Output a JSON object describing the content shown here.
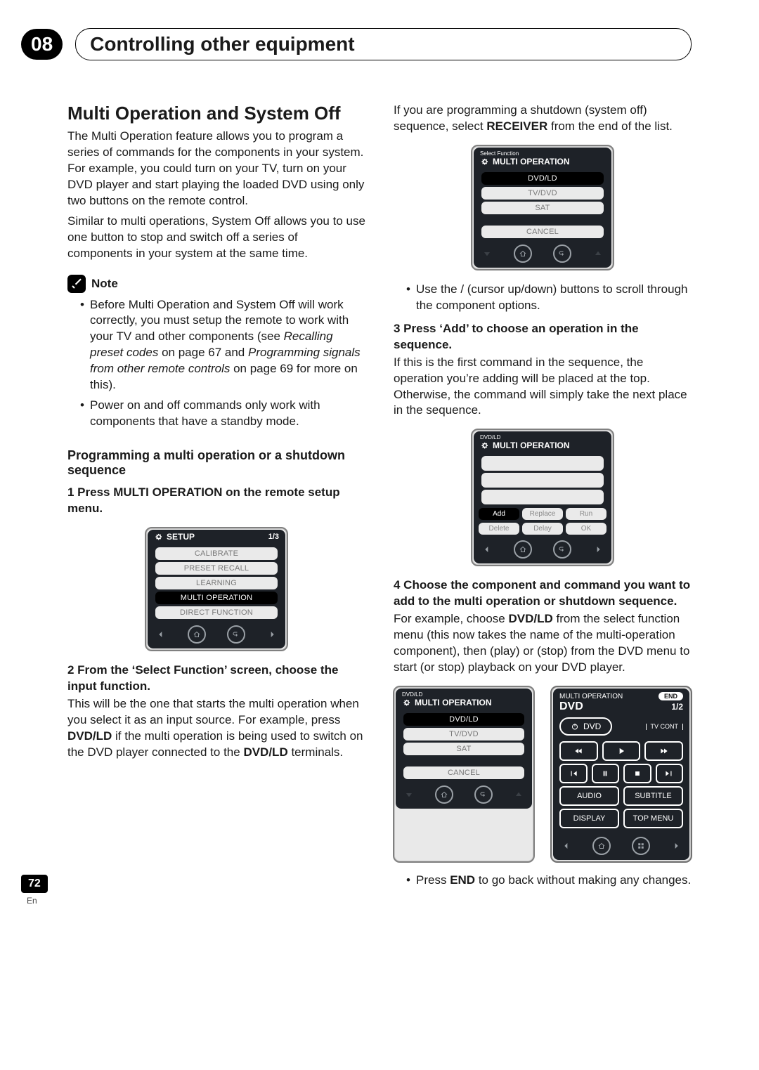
{
  "chapter": {
    "number": "08",
    "title": "Controlling other equipment"
  },
  "section_title": "Multi Operation and System Off",
  "intro_p1": "The Multi Operation feature allows you to program a series of commands for the components in your system. For example, you could turn on your TV, turn on your DVD player and start playing the loaded DVD using only two buttons on the remote control.",
  "intro_p2": "Similar to multi operations, System Off allows you to use one button to stop and switch off a series of components in your system at the same time.",
  "note_label": "Note",
  "note_b1_a": "Before Multi Operation and System Off will work correctly, you must setup the remote to work with your TV and other components (see ",
  "note_b1_i1": "Recalling preset codes",
  "note_b1_b": " on page 67 and ",
  "note_b1_i2": "Programming signals from other remote controls",
  "note_b1_c": " on page 69 for more on this).",
  "note_b2": "Power on and off commands only work with components that have a standby mode.",
  "subheading": "Programming a multi operation or a shutdown sequence",
  "step1": "1   Press MULTI OPERATION on the remote setup menu.",
  "lcd_setup": {
    "title": "SETUP",
    "page": "1/3",
    "items": [
      "CALIBRATE",
      "PRESET RECALL",
      "LEARNING",
      "MULTI OPERATION",
      "DIRECT FUNCTION"
    ],
    "selected": 3
  },
  "step2_t": "2   From the ‘Select Function’ screen, choose the input function.",
  "step2_p_a": "This will be the one that starts the multi operation when you select it as an input source. For example, press ",
  "step2_p_b": "DVD/LD",
  "step2_p_c": " if the multi operation is being used to switch on the DVD player connected to the ",
  "step2_p_d": "DVD/LD",
  "step2_p_e": " terminals.",
  "right_intro_a": "If you are programming a shutdown (system off) sequence, select ",
  "right_intro_b": "RECEIVER",
  "right_intro_c": " from the end of the list.",
  "lcd_selfn": {
    "crumb": "Select Function",
    "title": "MULTI OPERATION",
    "items": [
      "DVD/LD",
      "TV/DVD",
      "SAT"
    ],
    "cancel": "CANCEL",
    "selected": 0
  },
  "tip1_a": "Use the ",
  "tip1_arrows": " / ",
  "tip1_b": " (cursor up/down) buttons to scroll through the component options.",
  "step3_t": "3   Press ‘Add’ to choose an operation in the sequence.",
  "step3_p": "If this is the first command in the sequence, the operation you’re adding will be placed at the top. Otherwise, the command will simply take the next place in the sequence.",
  "lcd_add": {
    "crumb": "DVD/LD",
    "title": "MULTI OPERATION",
    "buttons_row1": [
      "Add",
      "Replace",
      "Run"
    ],
    "buttons_row2": [
      "Delete",
      "Delay",
      "OK"
    ],
    "selected": 0
  },
  "step4_t": "4   Choose the component and command you want to add to the multi operation or shutdown sequence.",
  "step4_p_a": "For example, choose ",
  "step4_p_b": "DVD/LD",
  "step4_p_c": " from the select function menu (this now takes the name of the multi-operation component), then      (play) or      (stop) from the DVD menu to start (or stop) playback on your DVD player.",
  "lcd_selfn2": {
    "crumb": "DVD/LD",
    "title": "MULTI OPERATION",
    "items": [
      "DVD/LD",
      "TV/DVD",
      "SAT"
    ],
    "cancel": "CANCEL",
    "selected": 0
  },
  "lcd_dvd": {
    "pre": "MULTI OPERATION",
    "end": "END",
    "title": "DVD",
    "page": "1/2",
    "power_label": "DVD",
    "tv_cont": "TV\nCONT",
    "labels": {
      "audio": "AUDIO",
      "subtitle": "SUBTITLE",
      "display": "DISPLAY",
      "topmenu": "TOP MENU"
    }
  },
  "tip2_a": "Press ",
  "tip2_b": "END",
  "tip2_c": " to go back without making any changes.",
  "page_number": "72",
  "lang": "En"
}
